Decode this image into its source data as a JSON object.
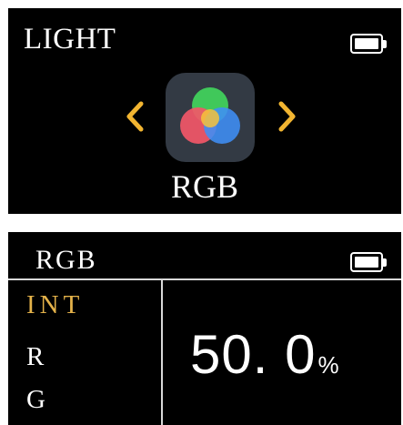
{
  "light_screen": {
    "title": "LIGHT",
    "mode_label": "RGB",
    "icons": {
      "battery": "battery-full-icon",
      "prev": "chevron-left-icon",
      "next": "chevron-right-icon",
      "app": "rgb-color-circles-icon"
    },
    "colors": {
      "chevron": "#f2b531",
      "circle_red": "#f25768",
      "circle_green": "#40c85a",
      "circle_blue": "#3f8ef6",
      "circle_yellow": "#f6c33b",
      "icon_bg": "#333a44"
    }
  },
  "rgb_screen": {
    "title": "RGB",
    "params": [
      {
        "label": "INT",
        "active": true
      },
      {
        "label": "R",
        "active": false
      },
      {
        "label": "G",
        "active": false
      }
    ],
    "value": "50. 0",
    "unit": "%",
    "colors": {
      "active_param": "#e4b24a",
      "divider": "#d8d8d8"
    }
  }
}
